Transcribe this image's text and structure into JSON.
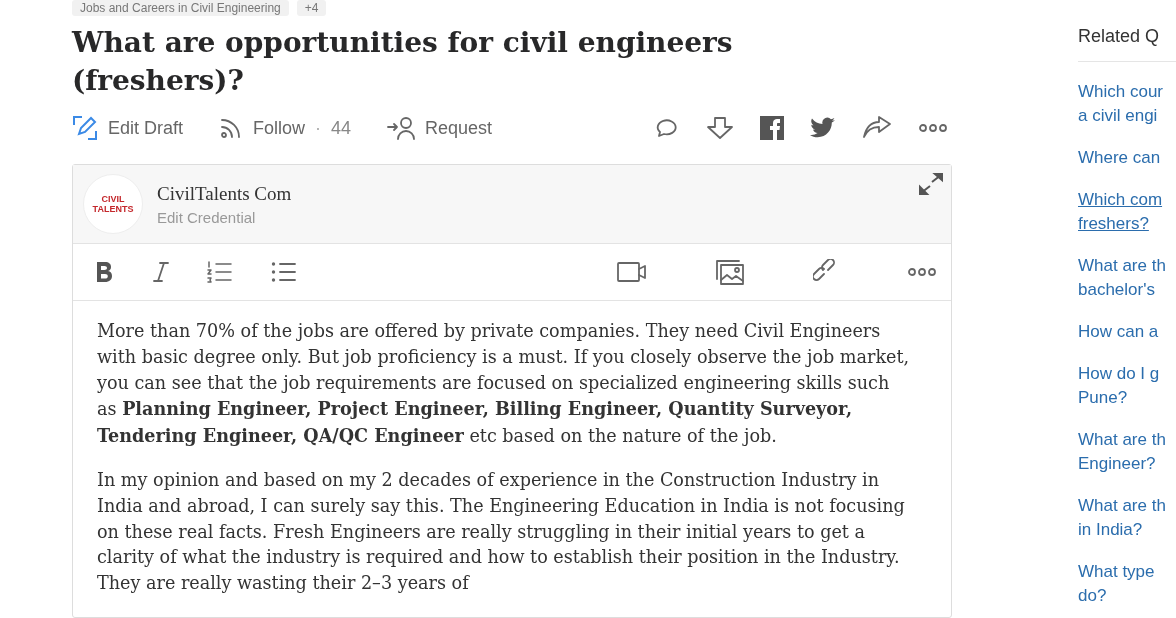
{
  "topics": {
    "tag": "Jobs and Careers in Civil Engineering",
    "more": "+4"
  },
  "question": {
    "title": "What are opportunities for civil engineers (freshers)?"
  },
  "actions": [
    {
      "kind": "edit",
      "label": "Edit Draft"
    },
    {
      "kind": "follow",
      "label": "Follow",
      "separator": "·",
      "count": "44"
    },
    {
      "kind": "request",
      "label": "Request"
    }
  ],
  "share_icons": [
    {
      "kind": "comment"
    },
    {
      "kind": "downvote"
    },
    {
      "kind": "facebook"
    },
    {
      "kind": "twitter"
    },
    {
      "kind": "share"
    },
    {
      "kind": "more"
    }
  ],
  "editor": {
    "author": "CivilTalents Com",
    "credential": "Edit Credential",
    "avatar_lines": [
      "CIVIL",
      "TALENTS"
    ],
    "toolbar_left": [
      {
        "kind": "bold"
      },
      {
        "kind": "italic"
      },
      {
        "kind": "numbered"
      },
      {
        "kind": "bulleted"
      }
    ],
    "toolbar_right": [
      {
        "kind": "video"
      },
      {
        "kind": "image"
      },
      {
        "kind": "link"
      },
      {
        "kind": "more"
      }
    ],
    "paragraphs": [
      "More than 70% of the jobs are offered by private companies. They need Civil Engineers with basic degree only. But job proficiency is a must. If you closely observe the job market, you can see that the job requirements are focused on specialized engineering skills such as **Planning Engineer, Project Engineer, Billing Engineer, Quantity Surveyor, Tendering Engineer, QA/QC Engineer** etc based on the nature of the job.",
      "In my opinion and based on my 2 decades of  experience in the Construction Industry in India and abroad, I can surely say this.  The  Engineering Education in India is not focusing on these real facts. Fresh Engineers are really struggling in their initial years to get a clarity of what the industry is required and how to establish their position in the Industry. They are really wasting their 2–3 years of"
    ]
  },
  "related": {
    "title": "Related Q",
    "items": [
      {
        "lines": [
          "Which cour",
          "a civil engi"
        ],
        "hovered": false
      },
      {
        "lines": [
          "Where can"
        ],
        "hovered": false
      },
      {
        "lines": [
          "Which com",
          "freshers?"
        ],
        "hovered": true
      },
      {
        "lines": [
          "What are th",
          "bachelor's"
        ],
        "hovered": false
      },
      {
        "lines": [
          "How can a"
        ],
        "hovered": false
      },
      {
        "lines": [
          "How do I g",
          "Pune?"
        ],
        "hovered": false
      },
      {
        "lines": [
          "What are th",
          "Engineer?"
        ],
        "hovered": false
      },
      {
        "lines": [
          "What are th",
          "in India?"
        ],
        "hovered": false
      },
      {
        "lines": [
          "What type",
          "do?"
        ],
        "hovered": false
      }
    ]
  }
}
